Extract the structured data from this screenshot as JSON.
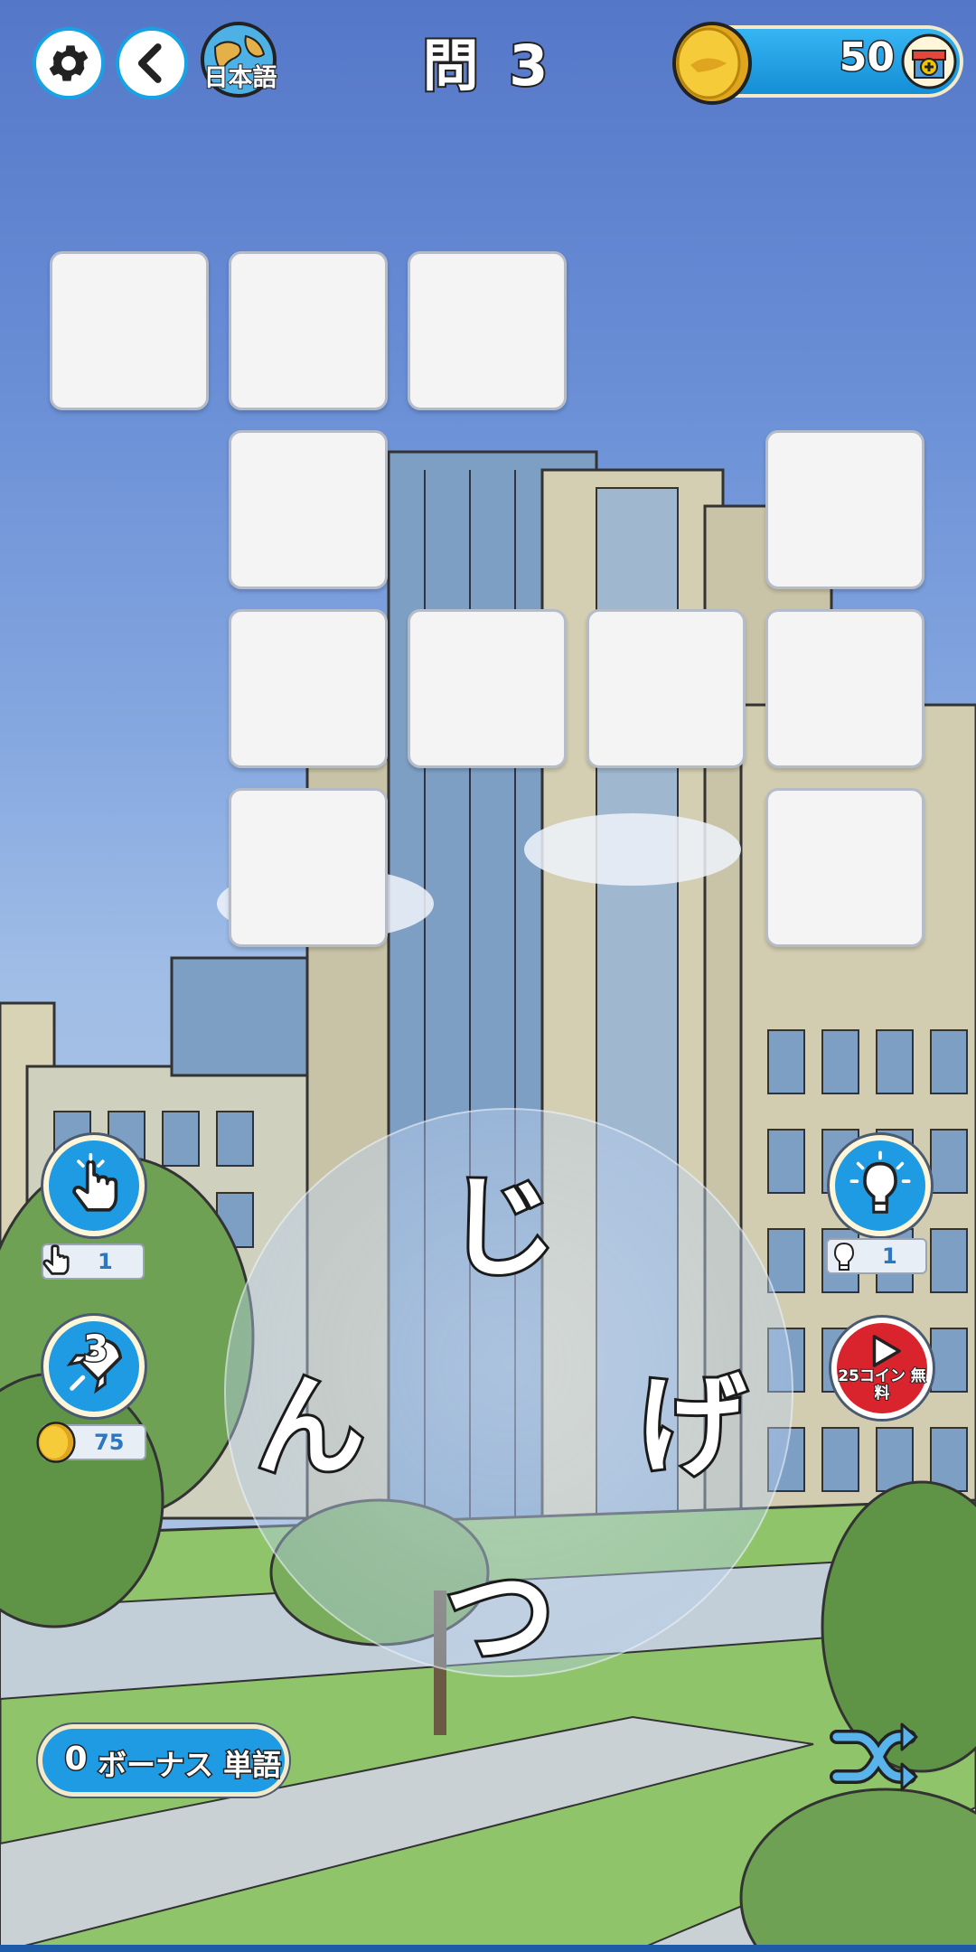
{
  "header": {
    "settings_icon": "gear-icon",
    "back_icon": "chevron-left-icon",
    "language_label": "日本語",
    "language_icon": "globe-icon",
    "level_title": "問 3",
    "coins": "50",
    "shop_icon": "shop-plus-icon"
  },
  "puzzle": {
    "tile_count": 11,
    "tiles_filled": 0
  },
  "tools": {
    "finger_hint": {
      "icon": "tap-finger-icon",
      "count": "1"
    },
    "rocket_hint": {
      "icon": "rocket-icon",
      "badge": "3",
      "cost": "75"
    },
    "bulb_hint": {
      "icon": "lightbulb-icon",
      "count": "1"
    },
    "video_reward": {
      "icon": "play-icon",
      "label": "25コイン 無料"
    }
  },
  "wheel": {
    "letters": [
      "じ",
      "ん",
      "げ",
      "つ"
    ]
  },
  "bonus": {
    "count": "0",
    "label": "ボーナス 単語"
  },
  "shuffle_icon": "shuffle-icon",
  "colors": {
    "accent_blue": "#1e9be3",
    "coin_gold": "#f4c430",
    "video_red": "#d9232d"
  }
}
